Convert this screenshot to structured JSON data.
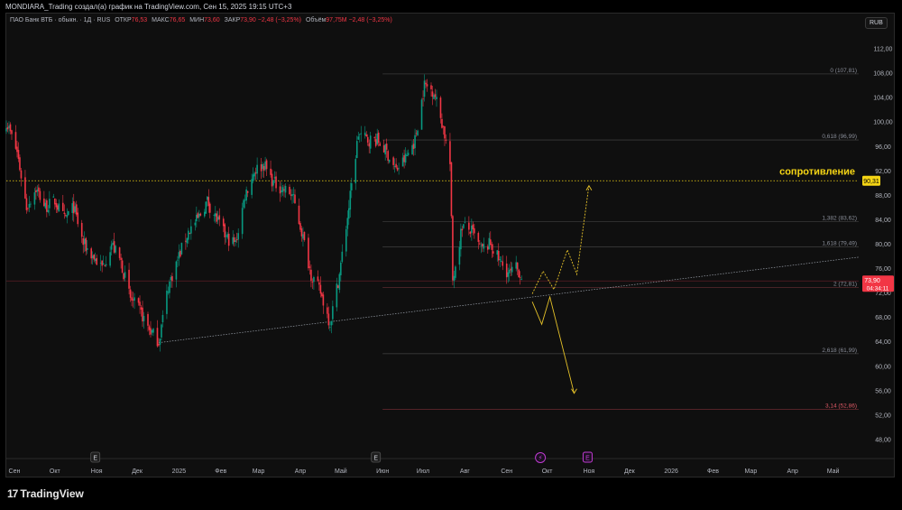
{
  "header": {
    "title": "MONDIARA_Trading создал(а) график на TradingView.com, Сен 15, 2025 19:15 UTC+3"
  },
  "legend": {
    "instrument": "ПАО Банк ВТБ · обыкн. · 1Д · RUS",
    "open_label": "ОТКР",
    "open": "76,53",
    "high_label": "МАКС",
    "high": "76,65",
    "low_label": "МИН",
    "low": "73,60",
    "close_label": "ЗАКР",
    "close": "73,90",
    "change": "−2,48 (−3,25%)",
    "volume_label": "Объём",
    "volume": "97,75M",
    "volume_change": "−2,48 (−3,25%)"
  },
  "currency": "RUB",
  "branding": {
    "logo_text": "TradingView",
    "logo_mark": "17"
  },
  "colors": {
    "up": "#089981",
    "down": "#f23645",
    "projection": "#e6c229",
    "resistance_text": "#f5d515",
    "price_badge": "#f23645",
    "resistance_badge": "#f5d515"
  },
  "chart_data": {
    "type": "candlestick",
    "ylim": [
      46,
      114
    ],
    "y_ticks": [
      "112,00",
      "108,00",
      "104,00",
      "100,00",
      "96,00",
      "92,00",
      "88,00",
      "84,00",
      "80,00",
      "76,00",
      "72,00",
      "68,00",
      "64,00",
      "60,00",
      "56,00",
      "52,00",
      "48,00"
    ],
    "y_tick_values": [
      112,
      108,
      104,
      100,
      96,
      92,
      88,
      84,
      80,
      76,
      72,
      68,
      64,
      60,
      56,
      52,
      48
    ],
    "x_start": "2024-08-26",
    "x_end": "2026-05-20",
    "x_ticks": [
      {
        "date": "2024-09-01",
        "label": "Сен"
      },
      {
        "date": "2024-10-01",
        "label": "Окт"
      },
      {
        "date": "2024-11-01",
        "label": "Ноя"
      },
      {
        "date": "2024-12-01",
        "label": "Дек"
      },
      {
        "date": "2025-01-01",
        "label": "2025"
      },
      {
        "date": "2025-02-01",
        "label": "Фев"
      },
      {
        "date": "2025-03-01",
        "label": "Мар"
      },
      {
        "date": "2025-04-01",
        "label": "Апр"
      },
      {
        "date": "2025-05-01",
        "label": "Май"
      },
      {
        "date": "2025-06-01",
        "label": "Июн"
      },
      {
        "date": "2025-07-01",
        "label": "Июл"
      },
      {
        "date": "2025-08-01",
        "label": "Авг"
      },
      {
        "date": "2025-09-01",
        "label": "Сен"
      },
      {
        "date": "2025-10-01",
        "label": "Окт"
      },
      {
        "date": "2025-11-01",
        "label": "Ноя"
      },
      {
        "date": "2025-12-01",
        "label": "Дек"
      },
      {
        "date": "2026-01-01",
        "label": "2026"
      },
      {
        "date": "2026-02-01",
        "label": "Фев"
      },
      {
        "date": "2026-03-01",
        "label": "Мар"
      },
      {
        "date": "2026-04-01",
        "label": "Апр"
      },
      {
        "date": "2026-05-01",
        "label": "Май"
      }
    ],
    "price_path": [
      [
        "2024-08-26",
        100
      ],
      [
        "2024-09-03",
        95
      ],
      [
        "2024-09-10",
        86
      ],
      [
        "2024-09-17",
        89
      ],
      [
        "2024-09-24",
        86
      ],
      [
        "2024-10-01",
        87
      ],
      [
        "2024-10-08",
        84
      ],
      [
        "2024-10-15",
        86
      ],
      [
        "2024-10-22",
        80
      ],
      [
        "2024-10-29",
        78
      ],
      [
        "2024-11-05",
        76
      ],
      [
        "2024-11-12",
        80
      ],
      [
        "2024-11-19",
        77
      ],
      [
        "2024-11-26",
        71
      ],
      [
        "2024-12-03",
        69
      ],
      [
        "2024-12-10",
        66
      ],
      [
        "2024-12-17",
        64
      ],
      [
        "2024-12-24",
        73
      ],
      [
        "2025-01-01",
        78
      ],
      [
        "2025-01-08",
        82
      ],
      [
        "2025-01-15",
        84
      ],
      [
        "2025-01-22",
        87
      ],
      [
        "2025-01-29",
        84
      ],
      [
        "2025-02-05",
        81
      ],
      [
        "2025-02-12",
        80
      ],
      [
        "2025-02-19",
        88
      ],
      [
        "2025-02-26",
        92
      ],
      [
        "2025-03-05",
        93
      ],
      [
        "2025-03-12",
        90
      ],
      [
        "2025-03-19",
        89
      ],
      [
        "2025-03-26",
        88
      ],
      [
        "2025-04-02",
        82
      ],
      [
        "2025-04-09",
        75
      ],
      [
        "2025-04-16",
        72
      ],
      [
        "2025-04-23",
        67
      ],
      [
        "2025-04-30",
        75
      ],
      [
        "2025-05-07",
        86
      ],
      [
        "2025-05-14",
        98
      ],
      [
        "2025-05-21",
        97
      ],
      [
        "2025-05-28",
        97
      ],
      [
        "2025-06-04",
        95
      ],
      [
        "2025-06-11",
        92
      ],
      [
        "2025-06-18",
        94
      ],
      [
        "2025-06-25",
        97
      ],
      [
        "2025-07-02",
        106
      ],
      [
        "2025-07-09",
        105
      ],
      [
        "2025-07-16",
        99
      ],
      [
        "2025-07-21",
        93
      ],
      [
        "2025-07-23",
        74
      ],
      [
        "2025-07-30",
        83
      ],
      [
        "2025-08-06",
        82
      ],
      [
        "2025-08-13",
        79
      ],
      [
        "2025-08-20",
        80
      ],
      [
        "2025-08-27",
        77
      ],
      [
        "2025-09-03",
        75
      ],
      [
        "2025-09-08",
        76
      ],
      [
        "2025-09-12",
        74.9
      ],
      [
        "2025-09-15",
        73.9
      ]
    ],
    "fib_levels": [
      {
        "ratio": "0",
        "label": "0 (107,81)",
        "value": 107.81
      },
      {
        "ratio": "0.618",
        "label": "0,618 (96,99)",
        "value": 96.99
      },
      {
        "ratio": "1.382",
        "label": "1,382 (83,62)",
        "value": 83.62
      },
      {
        "ratio": "1.618",
        "label": "1,618 (79,49)",
        "value": 79.49
      },
      {
        "ratio": "2",
        "label": "2 (72,81)",
        "value": 72.81
      },
      {
        "ratio": "2.618",
        "label": "2,618 (61,99)",
        "value": 61.99
      },
      {
        "ratio": "3.14",
        "label": "3,14 (52,86)",
        "value": 52.86
      }
    ],
    "resistance": {
      "label": "сопротивление",
      "value": 90.31,
      "badge": "90,31"
    },
    "current_price": {
      "value": 73.9,
      "badge": "73,90",
      "countdown": "04:34:11"
    },
    "trendline": {
      "start": [
        "2024-12-17",
        63.8
      ],
      "end": [
        "2026-05-20",
        77.8
      ]
    },
    "bull_projection": [
      [
        "2025-09-20",
        71.8
      ],
      [
        "2025-09-28",
        75.5
      ],
      [
        "2025-10-06",
        72.5
      ],
      [
        "2025-10-16",
        79
      ],
      [
        "2025-10-23",
        75
      ],
      [
        "2025-11-01",
        89.5
      ]
    ],
    "bear_projection": [
      [
        "2025-09-20",
        70.5
      ],
      [
        "2025-09-27",
        66.8
      ],
      [
        "2025-10-03",
        71.3
      ],
      [
        "2025-10-21",
        55.5
      ]
    ],
    "event_markers": [
      {
        "date": "2024-10-31",
        "type": "earnings",
        "glyph": "E"
      },
      {
        "date": "2025-05-27",
        "type": "earnings",
        "glyph": "E"
      },
      {
        "date": "2025-09-26",
        "type": "dividend",
        "glyph": "⚡"
      },
      {
        "date": "2025-10-31",
        "type": "earnings",
        "glyph": "E"
      }
    ]
  }
}
